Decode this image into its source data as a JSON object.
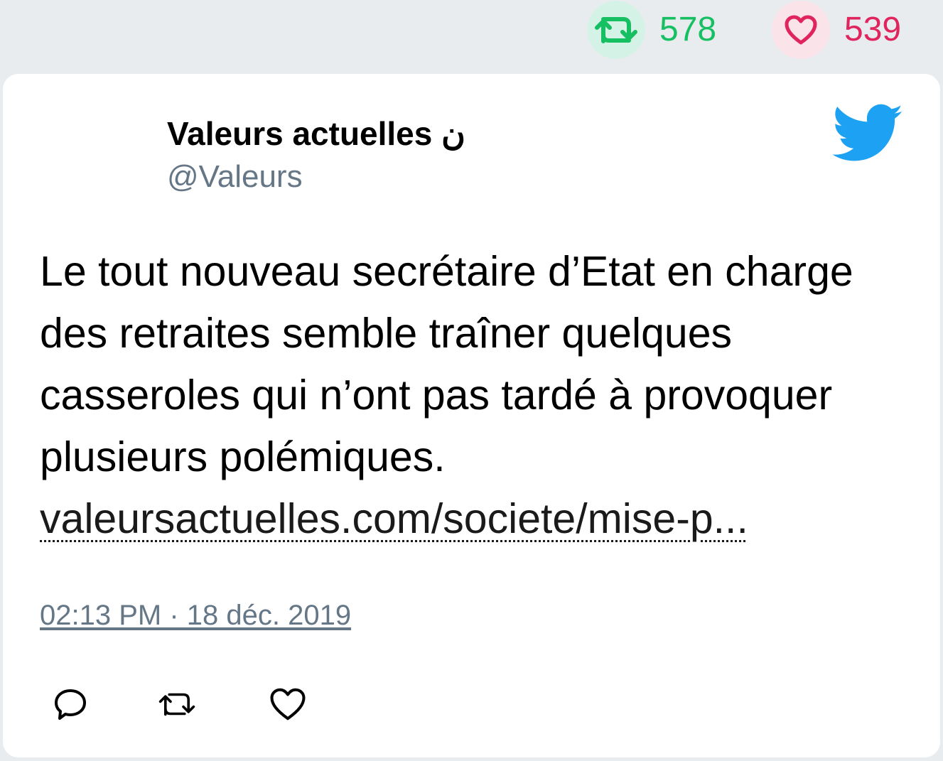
{
  "stats": {
    "retweets": "578",
    "likes": "539",
    "retweet_icon": "retweet-icon",
    "like_icon": "heart-icon",
    "retweet_color": "#17bf63",
    "like_color": "#e0245e"
  },
  "tweet": {
    "author_name": "Valeurs actuelles ن",
    "author_handle": "@Valeurs",
    "text": "Le tout nouveau secrétaire d’Etat en charge des retraites semble traîner quelques casseroles qui n’ont pas tardé à provoquer plusieurs polémiques. ",
    "link": "valeursactuelles.com/societe/mise-p...",
    "timestamp": "02:13 PM · 18 déc. 2019",
    "brand_icon": "twitter-bird-icon",
    "brand_color": "#1da1f2"
  },
  "actions": {
    "reply_icon": "reply-icon",
    "retweet_icon": "retweet-icon",
    "like_icon": "heart-icon"
  }
}
